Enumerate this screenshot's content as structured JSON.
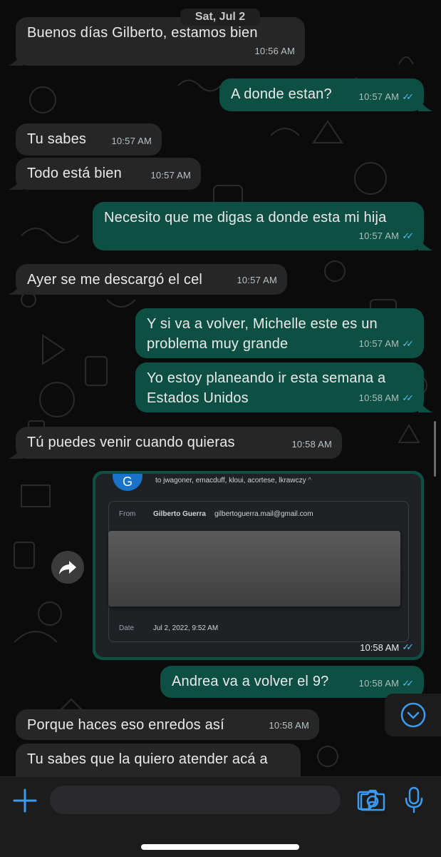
{
  "date_separator": "Sat, Jul 2",
  "messages": [
    {
      "text": "Buenos días Gilberto, estamos bien",
      "time": "10:56 AM"
    },
    {
      "text": "A donde estan?",
      "time": "10:57 AM"
    },
    {
      "text": "Tu sabes",
      "time": "10:57 AM"
    },
    {
      "text": "Todo está bien",
      "time": "10:57 AM"
    },
    {
      "text": "Necesito que me digas a donde esta mi hija",
      "time": "10:57 AM"
    },
    {
      "text": "Ayer se me descargó el cel",
      "time": "10:57 AM"
    },
    {
      "line1": "Y si va a volver, Michelle este es un",
      "line2": "problema muy grande",
      "time": "10:57 AM"
    },
    {
      "line1": "Yo estoy planeando ir esta semana a",
      "line2": "Estados Unidos",
      "time": "10:58 AM"
    },
    {
      "text": "Tú puedes venir cuando quieras",
      "time": "10:58 AM"
    },
    {
      "time": "10:58 AM"
    },
    {
      "text": "Andrea va a volver el 9?",
      "time": "10:58 AM"
    },
    {
      "text": "Porque haces eso enredos así",
      "time": "10:58 AM"
    },
    {
      "text": "Tu sabes que la quiero atender acá a"
    }
  ],
  "email_screenshot": {
    "avatar_letter": "G",
    "to_line": "to jwagoner, emacduff, kloui, acortese, lkrawczy",
    "from_label": "From",
    "from_name": "Gilberto Guerra",
    "from_email": "gilbertoguerra.mail@gmail.com",
    "date_label": "Date",
    "date_value": "Jul 2, 2022, 9:52 AM"
  },
  "ticks_glyph": "✓✓",
  "colors": {
    "incoming_bubble": "#262626",
    "outgoing_bubble": "#0e4f43",
    "read_ticks": "#53bdeb",
    "accent_blue": "#3a9bf0"
  },
  "icons": {
    "composer_left": "plus-icon",
    "sticker": "sticker-icon",
    "camera": "camera-icon",
    "mic": "microphone-icon",
    "forward": "forward-share-icon",
    "scroll_down": "chevron-down-circle-icon"
  }
}
